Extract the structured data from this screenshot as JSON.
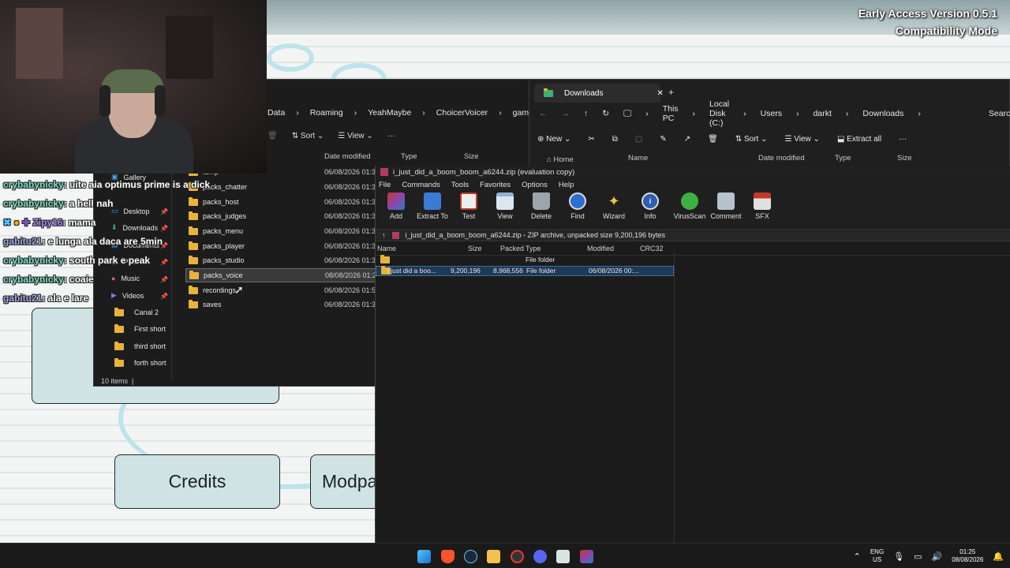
{
  "game": {
    "version_line1": "Early Access Version 0.5.1",
    "version_line2": "Compatibility Mode",
    "buttons": {
      "credits": "Credits",
      "modpacks": "Modpa"
    }
  },
  "chat": [
    {
      "user": "crybabynicky",
      "msg": ": uite aia optimus prime is a dick"
    },
    {
      "user": "crybabynicky",
      "msg": ": a hell nah"
    },
    {
      "user": "Zipy16",
      "msg": ": mama"
    },
    {
      "user": "gabitu21",
      "msg": ": e lunga ala daca are 5min"
    },
    {
      "user": "crybabynicky",
      "msg": ": south park e peak"
    },
    {
      "user": "crybabynicky",
      "msg": ": coaie"
    },
    {
      "user": "gabitu21",
      "msg": ": ala e lare"
    }
  ],
  "explorer": {
    "breadcrumb": [
      "Data",
      "Roaming",
      "YeahMaybe",
      "ChoicerVoicer",
      "game"
    ],
    "toolbar": {
      "sort": "Sort",
      "view": "View",
      "more": "···"
    },
    "columns": {
      "date": "Date modified",
      "type": "Type",
      "size": "Size"
    },
    "nav": [
      {
        "label": "Gallery",
        "icon": "gallery-icon",
        "pinned": false
      },
      {
        "label": "Desktop",
        "icon": "desktop-icon",
        "pinned": true
      },
      {
        "label": "Downloads",
        "icon": "download-icon",
        "pinned": true
      },
      {
        "label": "Documents",
        "icon": "document-icon",
        "pinned": true
      },
      {
        "label": "Pictures",
        "icon": "picture-icon",
        "pinned": true
      },
      {
        "label": "Music",
        "icon": "music-icon",
        "pinned": true
      },
      {
        "label": "Videos",
        "icon": "video-icon",
        "pinned": true
      },
      {
        "label": "Canal 2",
        "icon": "folder-icon",
        "pinned": false
      },
      {
        "label": "First short",
        "icon": "folder-icon",
        "pinned": false
      },
      {
        "label": "third short",
        "icon": "folder-icon",
        "pinned": false
      },
      {
        "label": "forth short",
        "icon": "folder-icon",
        "pinned": false
      }
    ],
    "files": [
      {
        "name": "temp",
        "date": "06/08/2026 01:35"
      },
      {
        "name": "packs_chatter",
        "date": "06/08/2026 01:35"
      },
      {
        "name": "packs_host",
        "date": "06/08/2026 01:35"
      },
      {
        "name": "packs_judges",
        "date": "06/08/2026 01:35"
      },
      {
        "name": "packs_menu",
        "date": "06/08/2026 01:35"
      },
      {
        "name": "packs_player",
        "date": "06/08/2026 01:35"
      },
      {
        "name": "packs_studio",
        "date": "06/08/2026 01:35"
      },
      {
        "name": "packs_voice",
        "date": "08/08/2026 01:25"
      },
      {
        "name": "recordings",
        "date": "06/08/2026 01:57"
      },
      {
        "name": "saves",
        "date": "06/08/2026 01:35"
      }
    ],
    "status": "10 items"
  },
  "downloads": {
    "tab_title": "Downloads",
    "breadcrumb": [
      "This PC",
      "Local Disk (C:)",
      "Users",
      "darkt",
      "Downloads"
    ],
    "search_placeholder": "Search",
    "toolbar": {
      "new": "New",
      "sort": "Sort",
      "view": "View",
      "extract": "Extract all",
      "more": "···"
    },
    "columns": {
      "home": "Home",
      "name": "Name",
      "date": "Date modified",
      "type": "Type",
      "size": "Size"
    }
  },
  "winrar": {
    "title": "i_just_did_a_boom_boom_a6244.zip (evaluation copy)",
    "menu": [
      "File",
      "Commands",
      "Tools",
      "Favorites",
      "Options",
      "Help"
    ],
    "tools": [
      {
        "label": "Add",
        "color": "#c0392b"
      },
      {
        "label": "Extract To",
        "color": "#3a7bd5"
      },
      {
        "label": "Test",
        "color": "#c0392b"
      },
      {
        "label": "View",
        "color": "#8fb3d9"
      },
      {
        "label": "Delete",
        "color": "#9aa5ad"
      },
      {
        "label": "Find",
        "color": "#2d6fd1"
      },
      {
        "label": "Wizard",
        "color": "#e0c34c"
      },
      {
        "label": "Info",
        "color": "#2d5fb0"
      },
      {
        "label": "VirusScan",
        "color": "#3cb043"
      },
      {
        "label": "Comment",
        "color": "#b7c2cc"
      },
      {
        "label": "SFX",
        "color": "#c0392b"
      }
    ],
    "path": "i_just_did_a_boom_boom_a6244.zip - ZIP archive, unpacked size 9,200,196 bytes",
    "columns": {
      "name": "Name",
      "size": "Size",
      "packed": "Packed",
      "type": "Type",
      "modified": "Modified",
      "crc": "CRC32"
    },
    "rows": [
      {
        "name": "..",
        "size": "",
        "packed": "",
        "type": "File folder",
        "modified": ""
      },
      {
        "name": "i just did a boo...",
        "size": "9,200,196",
        "packed": "8,968,556",
        "type": "File folder",
        "modified": "06/08/2026 00:..."
      }
    ]
  },
  "taskbar": {
    "lang": "ENG",
    "region": "US",
    "time": "01:25",
    "date": "08/08/2026"
  }
}
